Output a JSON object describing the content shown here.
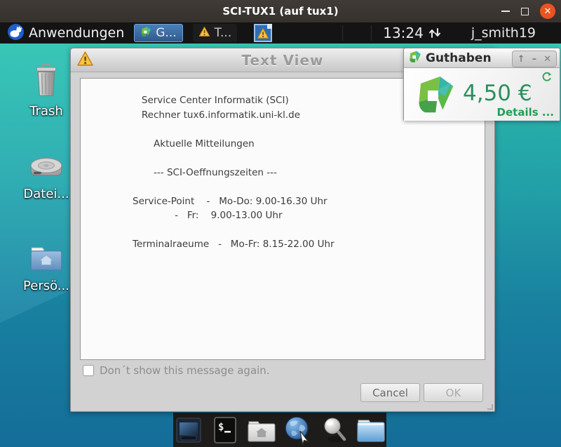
{
  "window": {
    "title": "SCI-TUX1 (auf tux1)"
  },
  "panel": {
    "menu_label": "Anwendungen",
    "tasks": [
      {
        "label": "G...",
        "icon": "papercut-logo-icon",
        "active": true
      },
      {
        "label": "T...",
        "icon": "warning-icon",
        "active": false
      }
    ],
    "tray": {
      "icon": "warning-icon"
    },
    "clock": "13:24",
    "traffic_icon": "up-down-arrows-icon",
    "username": "j_smith19"
  },
  "desktop": {
    "icons": [
      {
        "label": "Trash",
        "icon": "trash-icon"
      },
      {
        "label": "Datei...",
        "icon": "harddisk-icon"
      },
      {
        "label": "Persö...",
        "icon": "home-folder-icon"
      }
    ]
  },
  "dialog": {
    "title": "Text View",
    "title_icon": "warning-icon",
    "lines": [
      "   Service Center Informatik (SCI)",
      "   Rechner tux6.informatik.uni-kl.de",
      "",
      "       Aktuelle Mitteilungen",
      "",
      "       --- SCI-Oeffnungszeiten ---",
      "",
      "Service-Point    -   Mo-Do: 9.00-16.30 Uhr",
      "              -   Fr:    9.00-13.00 Uhr",
      "",
      "Terminalraeume   -   Mo-Fr: 8.15-22.00 Uhr"
    ],
    "checkbox_label": "Don´t show this message again.",
    "checkbox_checked": false,
    "cancel_label": "Cancel",
    "ok_label": "OK"
  },
  "widget": {
    "title": "Guthaben",
    "title_icon": "papercut-logo-icon",
    "controls": [
      "shade-icon",
      "minimize-icon",
      "close-icon"
    ],
    "refresh_icon": "refresh-icon",
    "amount": "4,50 €",
    "details_label": "Details ..."
  },
  "dock": {
    "items": [
      "show-desktop-icon",
      "terminal-icon",
      "home-folder-gray-icon",
      "web-browser-icon",
      "search-icon",
      "blue-folder-icon"
    ]
  },
  "colors": {
    "close_button_orange": "#e95420",
    "active_task_blue": "#3c6ea5",
    "balance_green": "#2e8f5e",
    "details_green": "#21a055",
    "desktop_teal_top": "#2cc3b2",
    "desktop_blue_bottom": "#15719e",
    "warning_yellow": "#f5c242"
  }
}
